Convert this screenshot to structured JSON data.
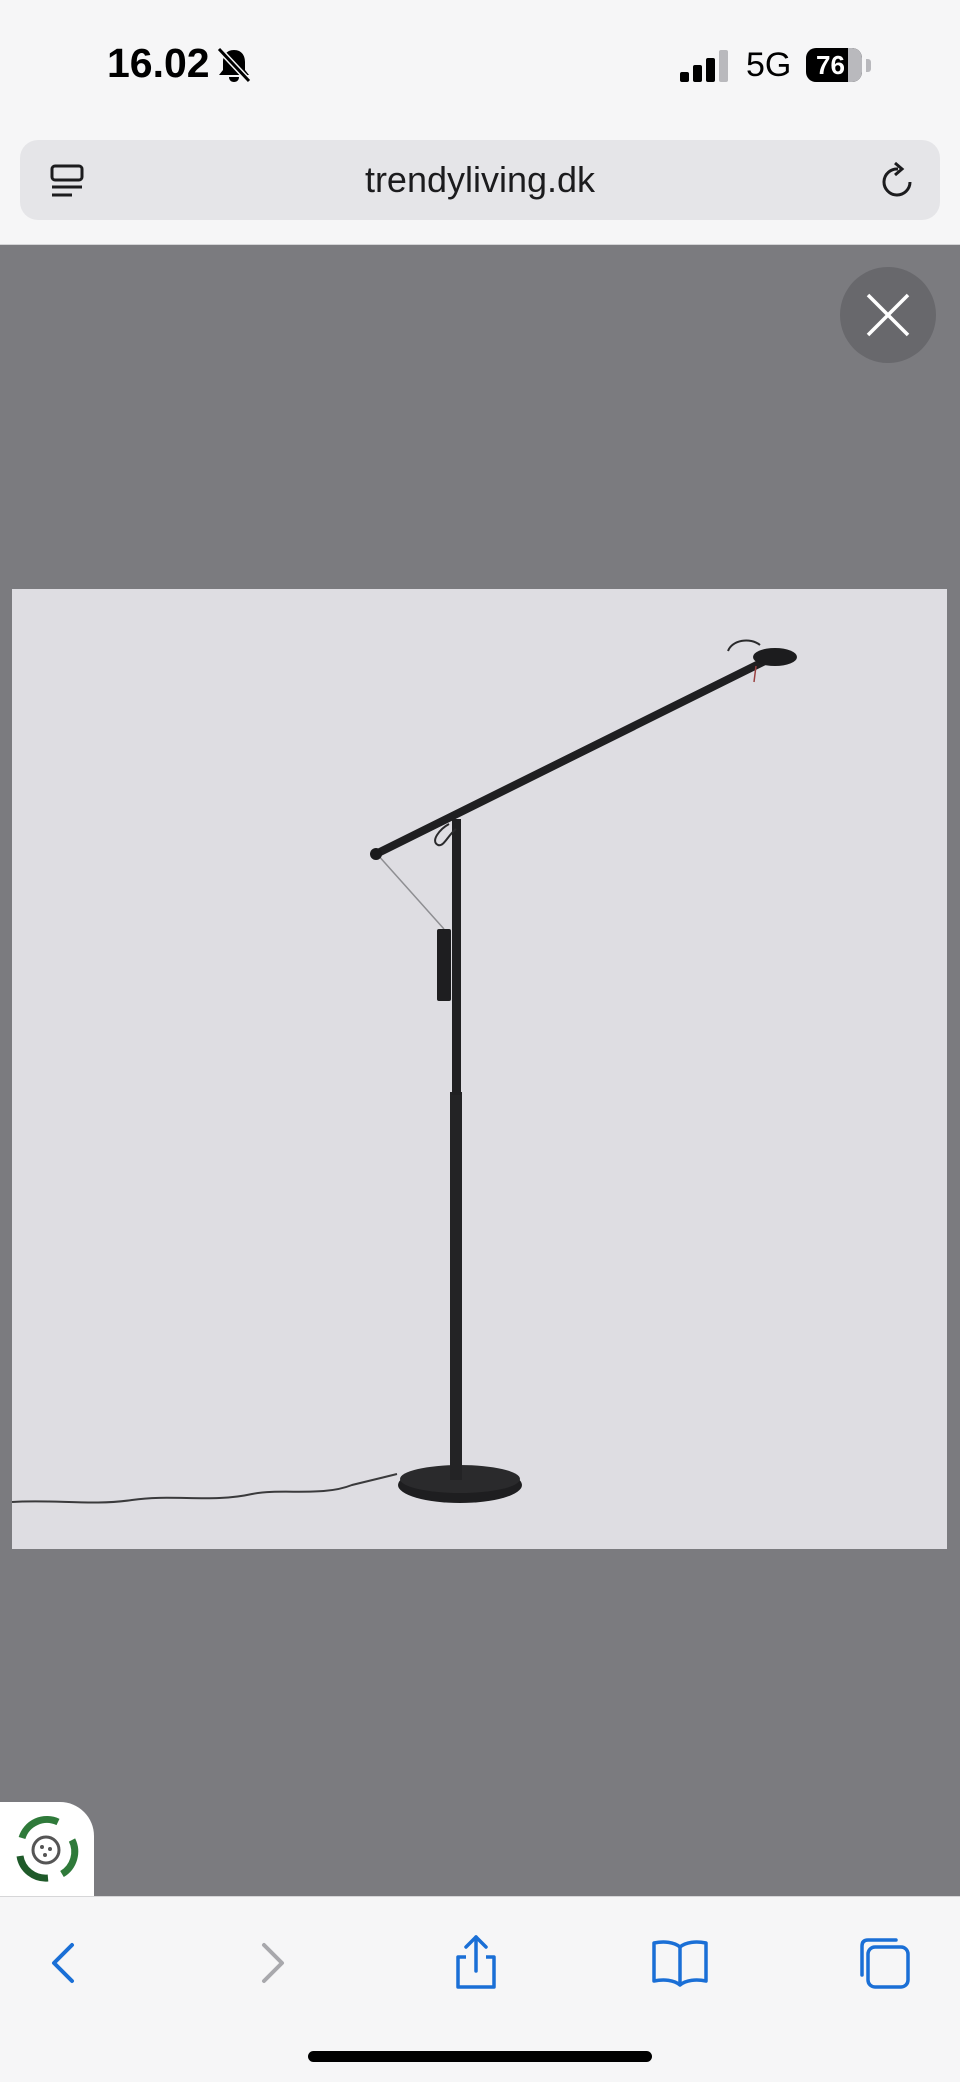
{
  "status_bar": {
    "time": "16.02",
    "network": "5G",
    "battery": "76"
  },
  "browser": {
    "url": "trendyliving.dk"
  },
  "colors": {
    "overlay": "#7b7b7f",
    "image_background": "#dedde2",
    "toolbar_accent": "#1a6fd6",
    "eco_green": "#2f7a3a"
  },
  "icons": {
    "bell_slash": "bell-slash-icon",
    "signal": "cellular-signal-icon",
    "reader": "reader-mode-icon",
    "reload": "reload-icon",
    "close": "close-icon",
    "eco": "eco-recycle-icon",
    "back": "chevron-left-icon",
    "forward": "chevron-right-icon",
    "share": "share-icon",
    "bookmarks": "book-icon",
    "tabs": "tabs-icon"
  }
}
